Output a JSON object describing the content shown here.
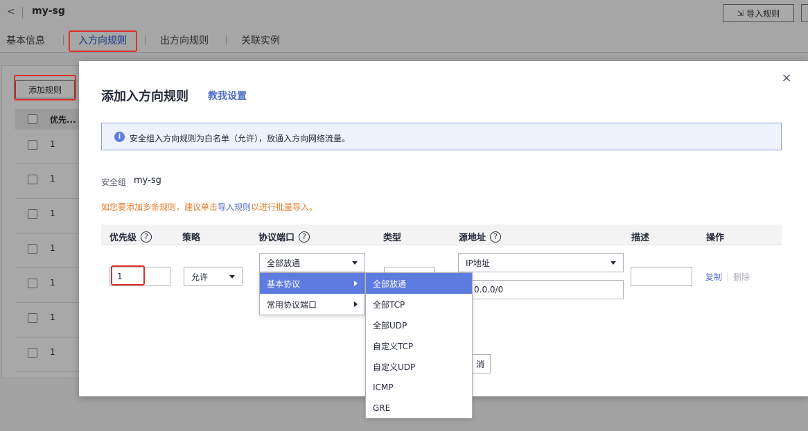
{
  "page": {
    "back_glyph": "<",
    "title": "my-sg",
    "import_button": "导入规则",
    "tabs": [
      "基本信息",
      "入方向规则",
      "出方向规则",
      "关联实例"
    ],
    "add_rule_button": "添加规则",
    "table_header_priority": "优先...",
    "rows": [
      "1",
      "1",
      "1",
      "1",
      "1",
      "1",
      "1"
    ]
  },
  "modal": {
    "title": "添加入方向规则",
    "help_link": "教我设置",
    "close_glyph": "×",
    "info_text": "安全组入方向规则为白名单（允许），放通入方向网络流量。",
    "security_group_label": "安全组",
    "security_group_name": "my-sg",
    "tip_prefix": "如您要添加多条规则，建议单击",
    "tip_link": "导入规则",
    "tip_suffix": "以进行批量导入。",
    "columns": {
      "priority": "优先级",
      "policy": "策略",
      "protocol_port": "协议端口",
      "type": "类型",
      "source": "源地址",
      "description": "描述",
      "action": "操作"
    },
    "help_glyph": "?",
    "row": {
      "priority_value": "1",
      "policy_value": "允许",
      "protocol_value": "全部放通",
      "source_type_value": "IP地址",
      "source_value": "0.0.0/0",
      "description_value": "",
      "copy_label": "复制",
      "delete_label": "删除"
    },
    "cancel_partial": "消"
  },
  "protocol_menu": {
    "items": [
      "基本协议",
      "常用协议端口"
    ],
    "selected_index": 0
  },
  "basic_protocol_submenu": {
    "items": [
      "全部放通",
      "全部TCP",
      "全部UDP",
      "自定义TCP",
      "自定义UDP",
      "ICMP",
      "GRE"
    ],
    "selected_index": 0
  },
  "colors": {
    "accent": "#5e7ce0",
    "link": "#526ecc",
    "warning_text": "#e87c2c",
    "highlight_box": "#e0302a"
  }
}
